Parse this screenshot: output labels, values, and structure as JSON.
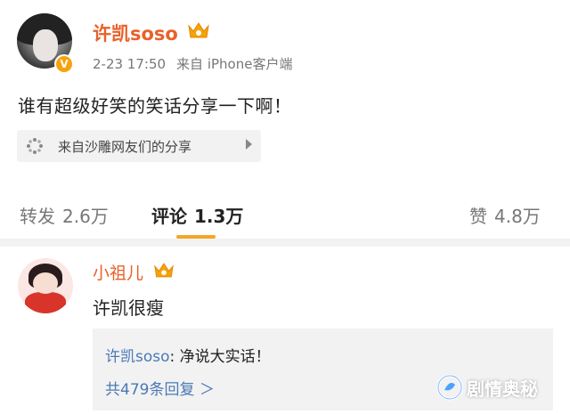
{
  "post": {
    "username": "许凯soso",
    "vip_badge": "V",
    "timestamp": "2-23 17:50",
    "source": "来自 iPhone客户端",
    "text": "谁有超级好笑的笑话分享一下啊！",
    "topic_chip": "来自沙雕网友们的分享"
  },
  "tabs": {
    "repost_label": "转发",
    "repost_count": "2.6万",
    "comment_label": "评论",
    "comment_count": "1.3万",
    "like_label": "赞",
    "like_count": "4.8万"
  },
  "comment": {
    "username": "小祖儿",
    "text": "许凯很瘦",
    "reply_user": "许凯soso",
    "reply_text": ": 净说大实话！",
    "reply_count": "共479条回复 ＞"
  },
  "watermark": {
    "text": "剧情奥秘"
  },
  "colors": {
    "username": "#e8612a",
    "link": "#4a79b5",
    "accent": "#f5a623",
    "badge": "#f5a20b"
  },
  "icons": [
    "vip-crown-icon",
    "verified-v-icon",
    "topic-dots-icon",
    "chevron-right-icon",
    "watermark-logo-icon"
  ]
}
